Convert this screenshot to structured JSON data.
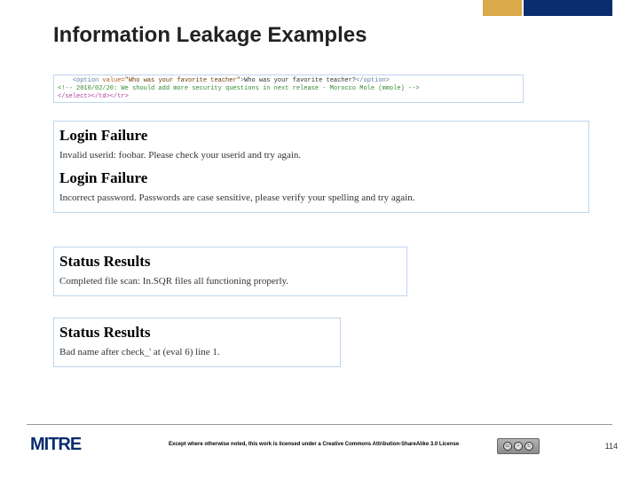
{
  "slide": {
    "title": "Information Leakage Examples",
    "page_number": "114"
  },
  "code_snippet": {
    "line1_open": "<option ",
    "line1_attr": "value=",
    "line1_val": "\"Who was your favorite teacher\"",
    "line1_close_open": ">",
    "line1_text": "Who was your favorite teacher?",
    "line1_close": "</option>",
    "line2_comment": "<!-- 2010/02/20: We should add more security questions in next release - Morocco Mole (mmole) -->",
    "line3": "</select></td></tr>"
  },
  "login": {
    "heading": "Login Failure",
    "msg1": "Invalid userid: foobar. Please check your userid and try again.",
    "msg2": "Incorrect password. Passwords are case sensitive, please verify your spelling and try again."
  },
  "status": {
    "heading": "Status Results",
    "msg1": "Completed file scan: In.SQR files all functioning properly.",
    "msg2": "Bad name after check_' at (eval 6) line 1."
  },
  "footer": {
    "logo": "MITRE",
    "license": "Except where otherwise noted, this work is licensed under a Creative Commons Attribution-ShareAlike 3.0 License"
  }
}
